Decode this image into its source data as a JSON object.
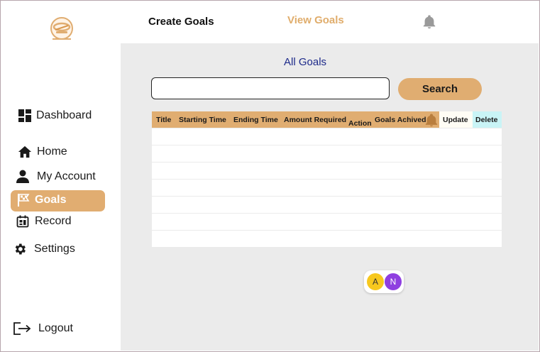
{
  "topnav": {
    "create_goals": "Create Goals",
    "view_goals": "View Goals"
  },
  "sidebar": {
    "items": [
      {
        "label": "Dashboard",
        "icon": "dashboard-icon"
      },
      {
        "label": "Home",
        "icon": "home-icon"
      },
      {
        "label": "My Account",
        "icon": "user-icon"
      },
      {
        "label": "Goals",
        "icon": "flag-icon",
        "active": true
      },
      {
        "label": "Record",
        "icon": "record-icon"
      },
      {
        "label": "Settings",
        "icon": "gear-icon"
      }
    ],
    "logout": "Logout"
  },
  "main": {
    "heading": "All Goals",
    "search": {
      "placeholder": "",
      "value": "",
      "button": "Search"
    },
    "table": {
      "columns": [
        "Title",
        "Starting Time",
        "Ending Time",
        "Amount Required",
        "Action",
        "Goals Achived",
        "Update",
        "Delete"
      ],
      "rows": []
    }
  },
  "collaborators": [
    "A",
    "N"
  ],
  "colors": {
    "accent": "#e0ad71",
    "main_bg": "#ebebeb",
    "heading": "#1d2a8a",
    "delete_bg": "#c9f4f6"
  }
}
